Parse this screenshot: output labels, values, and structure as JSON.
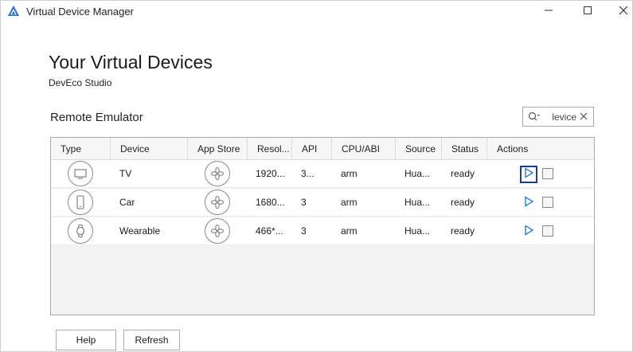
{
  "window": {
    "title": "Virtual Device Manager",
    "accent_color": "#1a6fd4"
  },
  "header": {
    "title": "Your Virtual Devices",
    "subtitle": "DevEco Studio"
  },
  "section": {
    "title": "Remote Emulator"
  },
  "search": {
    "value": "levice",
    "icon": "search-dropdown-icon"
  },
  "table": {
    "columns": [
      "Type",
      "Device",
      "App Store",
      "Resol...",
      "API",
      "CPU/ABI",
      "Source",
      "Status",
      "Actions"
    ],
    "rows": [
      {
        "type_icon": "tv-icon",
        "device": "TV",
        "app_store_icon": "app-store-icon",
        "resolution": "1920...",
        "api": "3...",
        "cpu": "arm",
        "source": "Hua...",
        "status": "ready"
      },
      {
        "type_icon": "phone-icon",
        "device": "Car",
        "app_store_icon": "app-store-icon",
        "resolution": "1680...",
        "api": "3",
        "cpu": "arm",
        "source": "Hua...",
        "status": "ready"
      },
      {
        "type_icon": "watch-icon",
        "device": "Wearable",
        "app_store_icon": "app-store-icon",
        "resolution": "466*...",
        "api": "3",
        "cpu": "arm",
        "source": "Hua...",
        "status": "ready"
      }
    ]
  },
  "footer": {
    "help_label": "Help",
    "refresh_label": "Refresh"
  }
}
